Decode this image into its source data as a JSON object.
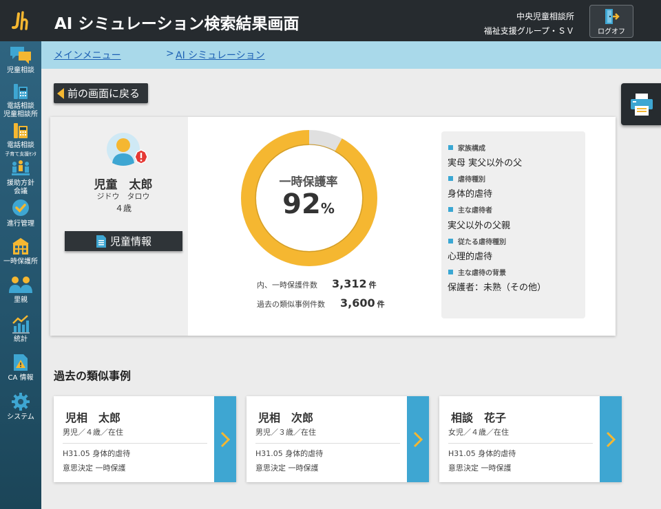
{
  "header": {
    "title": "AI シミュレーション検索結果画面",
    "org_name": "中央児童相談所",
    "group_name": "福祉支援グループ・ＳＶ",
    "logout_label": "ログオフ"
  },
  "sidebar": {
    "items": [
      {
        "label": "児童相談",
        "icon": "speech-bubble-icon"
      },
      {
        "label": "電話相談",
        "sub": "児童相談所",
        "icon": "phone-icon"
      },
      {
        "label": "電話相談",
        "sub": "子育て支援ｾﾝﾀ",
        "icon": "phone-icon"
      },
      {
        "label": "援助方針",
        "sub": "会議",
        "icon": "meeting-icon"
      },
      {
        "label": "進行管理",
        "icon": "check-icon"
      },
      {
        "label": "一時保護所",
        "icon": "building-icon"
      },
      {
        "label": "里親",
        "icon": "people-icon"
      },
      {
        "label": "統計",
        "icon": "chart-icon"
      },
      {
        "label": "CA 情報",
        "icon": "warning-icon"
      },
      {
        "label": "システム",
        "icon": "gear-icon"
      }
    ]
  },
  "breadcrumb": {
    "main_menu": "メインメニュー",
    "separator": ">",
    "current": "AI シミュレーション"
  },
  "back_button": "前の画面に戻る",
  "child": {
    "name": "児童　太郎",
    "kana": "ジドウ　タロウ",
    "age": "４歳",
    "info_button": "児童情報"
  },
  "result": {
    "rate_label": "一時保護率",
    "rate_value": "92",
    "rate_unit": "%",
    "rate_fraction": 0.92,
    "protected_label": "内、一時保護件数",
    "protected_value": "3,312",
    "similar_label": "過去の類似事例件数",
    "similar_value": "3,600",
    "count_unit": "件"
  },
  "attributes": [
    {
      "key": "家族構成",
      "value": "実母 実父以外の父"
    },
    {
      "key": "虐待種別",
      "value": "身体的虐待"
    },
    {
      "key": "主な虐待者",
      "value": "実父以外の父親"
    },
    {
      "key": "従たる虐待種別",
      "value": "心理的虐待"
    },
    {
      "key": "主な虐待の背景",
      "value": "保護者：未熟（その他）"
    }
  ],
  "similar_section_title": "過去の類似事例",
  "cases": [
    {
      "name": "児相　太郎",
      "meta": "男児／４歳／在住",
      "line1": "H31.05 身体的虐待",
      "line2": "意思決定 一時保護"
    },
    {
      "name": "児相　次郎",
      "meta": "男児／３歳／在住",
      "line1": "H31.05 身体的虐待",
      "line2": "意思決定 一時保護"
    },
    {
      "name": "相談　花子",
      "meta": "女児／４歳／在住",
      "line1": "H31.05 身体的虐待",
      "line2": "意思決定 一時保護"
    }
  ],
  "colors": {
    "header_bg": "#262b2f",
    "accent_yellow": "#f5b731",
    "accent_blue": "#3ea6d2",
    "breadcrumb_bg": "#a9d9ea"
  }
}
